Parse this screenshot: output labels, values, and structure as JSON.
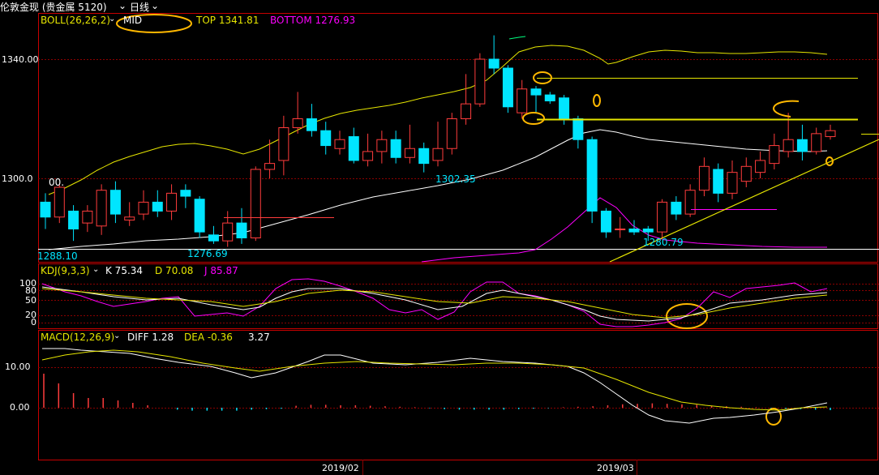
{
  "window": {
    "title": "伦敦金现 (贵金属 5120)",
    "period": "日线"
  },
  "boll": {
    "name": "BOLL(26,26,2)",
    "mid_label": "MID",
    "top_label": "TOP 1341.81",
    "bottom_label": "BOTTOM 1276.93"
  },
  "kdj": {
    "name": "KDJ(9,3,3)",
    "k_label": "K 75.34",
    "d_label": "D 70.08",
    "j_label": "J 85.87"
  },
  "macd": {
    "name": "MACD(12,26,9)",
    "diff_label": "DIFF 1.28",
    "dea_label": "DEA -0.36",
    "macd_value": "3.27"
  },
  "price_axis": {
    "t1": "1340.00",
    "t2": "1300.0"
  },
  "kdj_axis": {
    "t100": "100",
    "t80": "80",
    "t50": "50",
    "t20": "20",
    "t0": "0"
  },
  "macd_axis": {
    "t10": "10.00",
    "t0": "0.00"
  },
  "annotations": {
    "low1": "1276.69",
    "low2": "1302.35",
    "low3": "1280.79",
    "left_val": "1288.10",
    "left_val2": "00."
  },
  "dates": {
    "d1": "2019/02",
    "d2": "2019/03"
  },
  "colors": {
    "up": "#ff3c3c",
    "down": "#00e5ff",
    "panel_border": "#c80000",
    "grid": "#8b0000",
    "mid_line": "#ffffff",
    "top_bottom_line": "#e6e600",
    "k_line": "#ffffff",
    "d_line": "#e6e600",
    "j_line": "#ff00ff",
    "ellipse": "#ffb800"
  },
  "chart_data": [
    {
      "type": "candlestick",
      "title": "",
      "series": [
        {
          "name": "MID",
          "values": []
        },
        {
          "name": "TOP",
          "values": []
        },
        {
          "name": "BOTTOM",
          "values": []
        }
      ],
      "candles": [
        [
          1292,
          1287,
          1295,
          1283
        ],
        [
          1287,
          1297,
          1298,
          1285
        ],
        [
          1289,
          1283,
          1291,
          1279
        ],
        [
          1285,
          1289,
          1291,
          1282
        ],
        [
          1284,
          1296,
          1298,
          1281
        ],
        [
          1296,
          1288,
          1299,
          1285
        ],
        [
          1286,
          1287,
          1292,
          1284
        ],
        [
          1288,
          1292,
          1296,
          1286
        ],
        [
          1292,
          1289,
          1296,
          1287
        ],
        [
          1289,
          1295,
          1298,
          1286
        ],
        [
          1296,
          1294,
          1298,
          1290
        ],
        [
          1293,
          1282,
          1294,
          1280
        ],
        [
          1281,
          1279,
          1284,
          1278
        ],
        [
          1279,
          1285,
          1289,
          1277
        ],
        [
          1285,
          1280,
          1290,
          1278
        ],
        [
          1280,
          1303,
          1304,
          1279
        ],
        [
          1303,
          1305,
          1313,
          1300
        ],
        [
          1306,
          1317,
          1321,
          1301
        ],
        [
          1317,
          1320,
          1329,
          1315
        ],
        [
          1320,
          1316,
          1325,
          1314
        ],
        [
          1316,
          1311,
          1319,
          1308
        ],
        [
          1310,
          1313,
          1316,
          1308
        ],
        [
          1314,
          1306,
          1317,
          1305
        ],
        [
          1306,
          1309,
          1315,
          1304
        ],
        [
          1309,
          1313,
          1316,
          1305
        ],
        [
          1313,
          1307,
          1316,
          1305
        ],
        [
          1307,
          1310,
          1318,
          1305
        ],
        [
          1310,
          1305,
          1312,
          1302
        ],
        [
          1306,
          1310,
          1319,
          1304
        ],
        [
          1310,
          1320,
          1322,
          1308
        ],
        [
          1320,
          1325,
          1335,
          1318
        ],
        [
          1325,
          1340,
          1342,
          1324
        ],
        [
          1340,
          1337,
          1348,
          1335
        ],
        [
          1337,
          1324,
          1338,
          1322
        ],
        [
          1322,
          1330,
          1333,
          1320
        ],
        [
          1330,
          1328,
          1331,
          1322
        ],
        [
          1328,
          1326,
          1329,
          1325
        ],
        [
          1327,
          1320,
          1328,
          1318
        ],
        [
          1320,
          1313,
          1321,
          1310
        ],
        [
          1313,
          1289,
          1314,
          1285
        ],
        [
          1289,
          1282,
          1290,
          1280
        ],
        [
          1283,
          1283,
          1287,
          1280
        ],
        [
          1283,
          1282,
          1286,
          1281
        ],
        [
          1283,
          1282,
          1284,
          1279
        ],
        [
          1282,
          1292,
          1293,
          1280
        ],
        [
          1292,
          1288,
          1294,
          1286
        ],
        [
          1288,
          1296,
          1298,
          1287
        ],
        [
          1296,
          1304,
          1307,
          1294
        ],
        [
          1303,
          1295,
          1305,
          1292
        ],
        [
          1295,
          1302,
          1306,
          1293
        ],
        [
          1299,
          1304,
          1307,
          1297
        ],
        [
          1302,
          1306,
          1309,
          1300
        ],
        [
          1305,
          1311,
          1315,
          1303
        ],
        [
          1309,
          1313,
          1322,
          1307
        ],
        [
          1313,
          1309,
          1318,
          1306
        ],
        [
          1309,
          1315,
          1317,
          1308
        ],
        [
          1314,
          1316,
          1318,
          1313
        ]
      ],
      "ylim": [
        1270,
        1350
      ],
      "xlabel": "",
      "ylabel": ""
    },
    {
      "type": "line",
      "title": "",
      "series": [
        {
          "name": "K",
          "values": []
        },
        {
          "name": "D",
          "values": []
        },
        {
          "name": "J",
          "values": []
        }
      ],
      "ylim": [
        0,
        100
      ]
    },
    {
      "type": "bar",
      "title": "",
      "series": [
        {
          "name": "DIFF",
          "values": []
        },
        {
          "name": "DEA",
          "values": []
        }
      ]
    }
  ]
}
